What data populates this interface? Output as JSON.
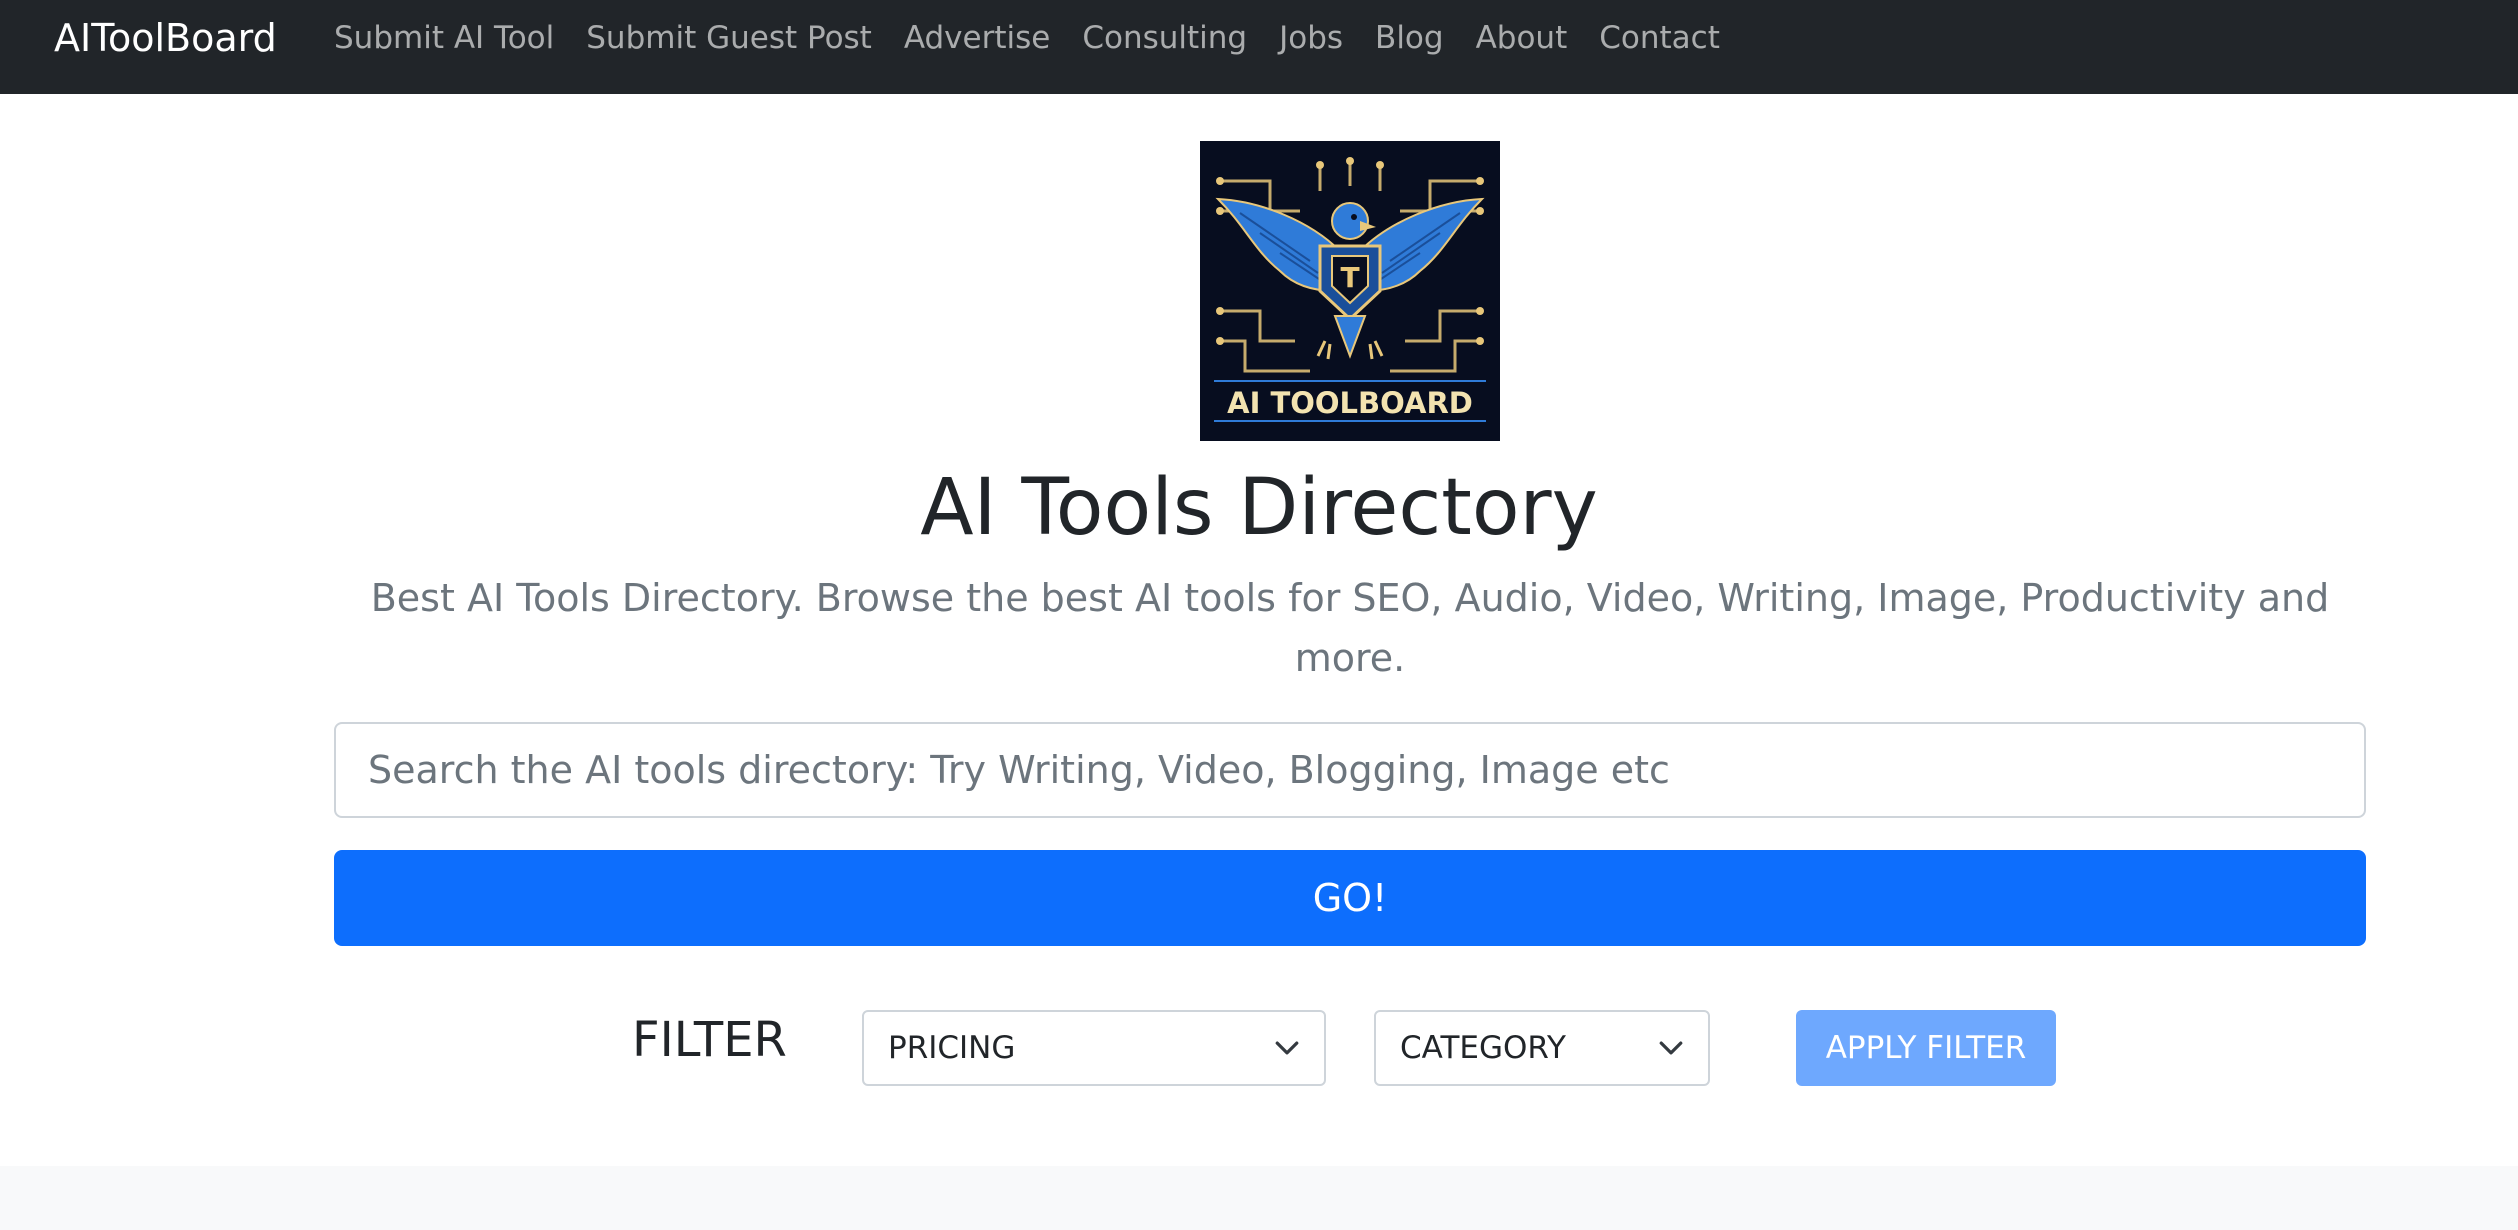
{
  "nav": {
    "brand": "AIToolBoard",
    "links": [
      {
        "label": "Submit AI Tool"
      },
      {
        "label": "Submit Guest Post"
      },
      {
        "label": "Advertise"
      },
      {
        "label": "Consulting"
      },
      {
        "label": "Jobs"
      },
      {
        "label": "Blog"
      },
      {
        "label": "About"
      },
      {
        "label": "Contact"
      }
    ]
  },
  "hero": {
    "logo_text": "AI TOOLBOARD",
    "logo_monogram": "T",
    "title": "AI Tools Directory",
    "lead": "Best AI Tools Directory. Browse the best AI tools for SEO, Audio, Video, Writing, Image, Productivity and more."
  },
  "search": {
    "value": "",
    "placeholder": "Search the AI tools directory: Try Writing, Video, Blogging, Image etc",
    "button_label": "GO!"
  },
  "filter": {
    "label": "FILTER",
    "pricing": {
      "selected": "PRICING",
      "icon": "chevron-down-icon"
    },
    "category": {
      "selected": "CATEGORY",
      "icon": "chevron-down-icon"
    },
    "apply_label": "APPLY FILTER"
  },
  "colors": {
    "navbar": "#212529",
    "primary": "#0d6efd",
    "primary_light": "#6ea8fe",
    "muted_text": "#6c757d",
    "logo_bg": "#070d1f",
    "logo_gold": "#e8c77a",
    "logo_blue": "#2f7bd8"
  }
}
